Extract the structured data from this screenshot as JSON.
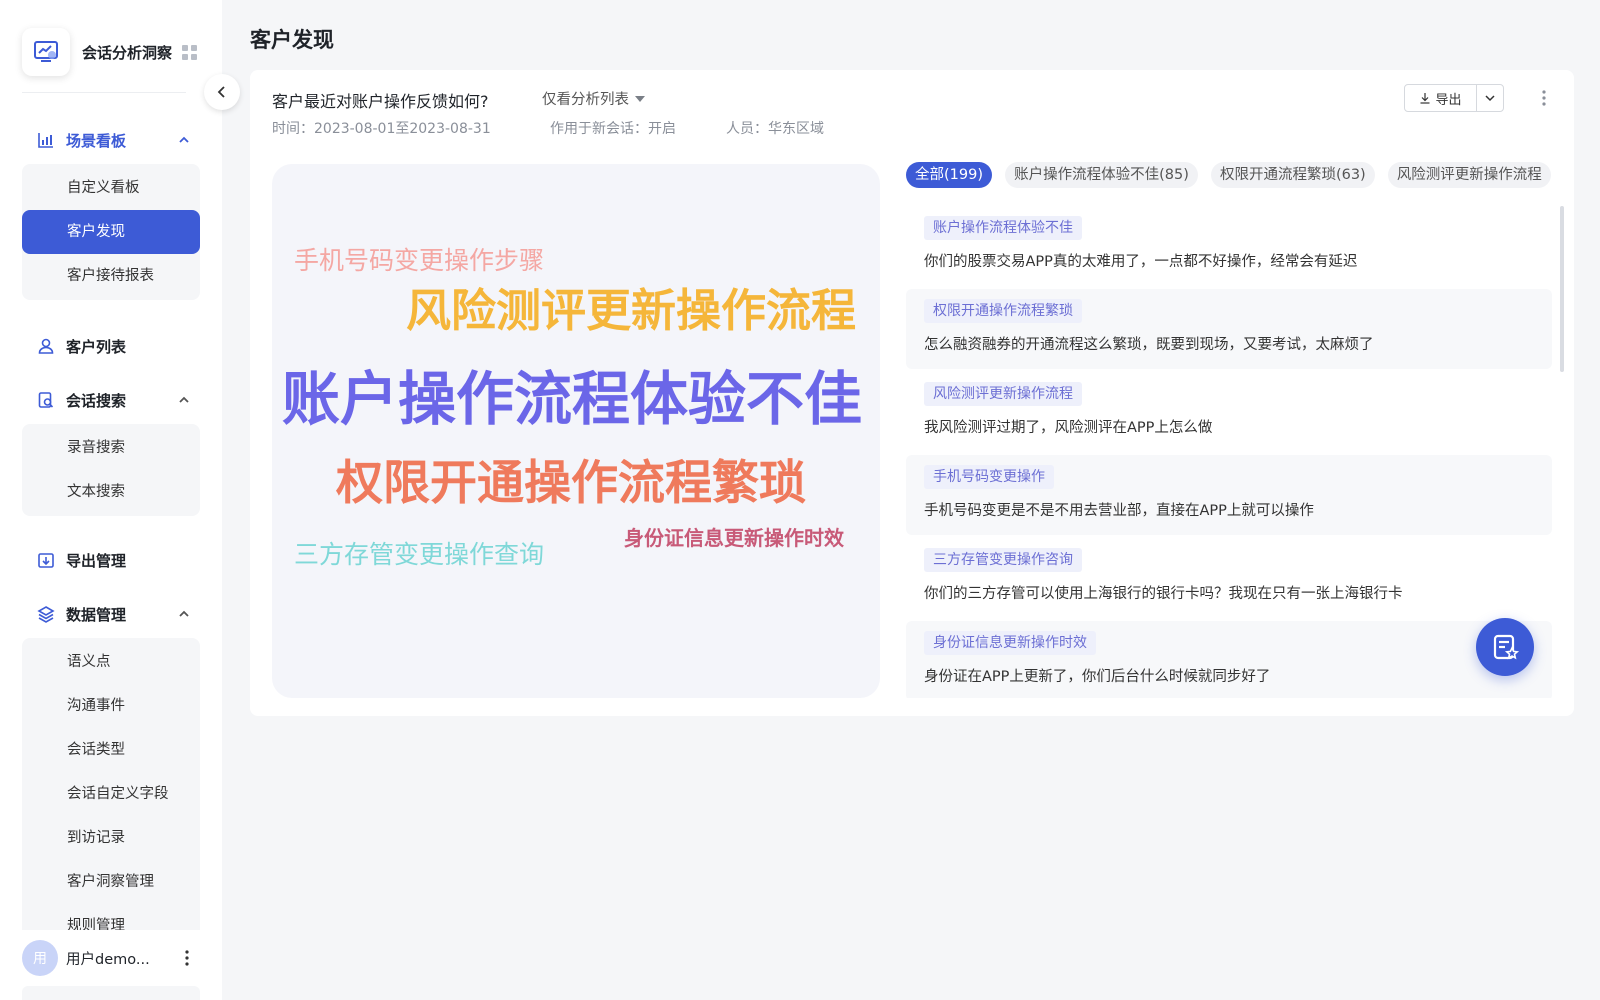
{
  "app": {
    "name": "会话分析洞察"
  },
  "colors": {
    "accent": "#3d5bd6",
    "tag_text": "#6c6fd4",
    "tag_bg": "#eef0fb"
  },
  "nav": {
    "groups": [
      {
        "label": "场景看板",
        "icon": "bar-chart-icon",
        "active": true,
        "items": [
          {
            "label": "自定义看板"
          },
          {
            "label": "客户发现",
            "active": true
          },
          {
            "label": "客户接待报表"
          }
        ]
      },
      {
        "label": "客户列表",
        "icon": "user-icon"
      },
      {
        "label": "会话搜索",
        "icon": "search-doc-icon",
        "items": [
          {
            "label": "录音搜索"
          },
          {
            "label": "文本搜索"
          }
        ]
      },
      {
        "label": "导出管理",
        "icon": "export-icon"
      },
      {
        "label": "数据管理",
        "icon": "layers-icon",
        "items": [
          {
            "label": "语义点"
          },
          {
            "label": "沟通事件"
          },
          {
            "label": "会话类型"
          },
          {
            "label": "会话自定义字段"
          },
          {
            "label": "到访记录"
          },
          {
            "label": "客户洞察管理"
          },
          {
            "label": "规则管理"
          }
        ]
      }
    ]
  },
  "user": {
    "avatar_text": "用",
    "name": "用户demo..."
  },
  "page": {
    "title": "客户发现"
  },
  "card": {
    "question": "客户最近对账户操作反馈如何?",
    "view_select": "仅看分析列表",
    "meta": {
      "time": "时间：2023-08-01至2023-08-31",
      "apply": "作用于新会话：开启",
      "people": "人员：华东区域"
    },
    "export_label": "导出"
  },
  "word_cloud": [
    {
      "text": "手机号码变更操作步骤",
      "color": "#f4a7a3"
    },
    {
      "text": "风险测评更新操作流程",
      "color": "#f5b63a"
    },
    {
      "text": "账户操作流程体验不佳",
      "color": "#6b66e8"
    },
    {
      "text": "权限开通操作流程繁琐",
      "color": "#ef7a5c"
    },
    {
      "text": "身份证信息更新操作时效",
      "color": "#c85a78"
    },
    {
      "text": "三方存管变更操作查询",
      "color": "#7fd8d8"
    }
  ],
  "tabs": [
    {
      "label": "全部(199)",
      "active": true
    },
    {
      "label": "账户操作流程体验不佳(85)"
    },
    {
      "label": "权限开通流程繁琐(63)"
    },
    {
      "label": "风险测评更新操作流程"
    }
  ],
  "feedback": [
    {
      "tag": "账户操作流程体验不佳",
      "text": "你们的股票交易APP真的太难用了，一点都不好操作，经常会有延迟"
    },
    {
      "tag": "权限开通操作流程繁琐",
      "text": "怎么融资融券的开通流程这么繁琐，既要到现场，又要考试，太麻烦了"
    },
    {
      "tag": "风险测评更新操作流程",
      "text": "我风险测评过期了，风险测评在APP上怎么做"
    },
    {
      "tag": "手机号码变更操作",
      "text": "手机号码变更是不是不用去营业部，直接在APP上就可以操作"
    },
    {
      "tag": "三方存管变更操作咨询",
      "text": "你们的三方存管可以使用上海银行的银行卡吗？我现在只有一张上海银行卡"
    },
    {
      "tag": "身份证信息更新操作时效",
      "text": "身份证在APP上更新了，你们后台什么时候就同步好了"
    }
  ]
}
